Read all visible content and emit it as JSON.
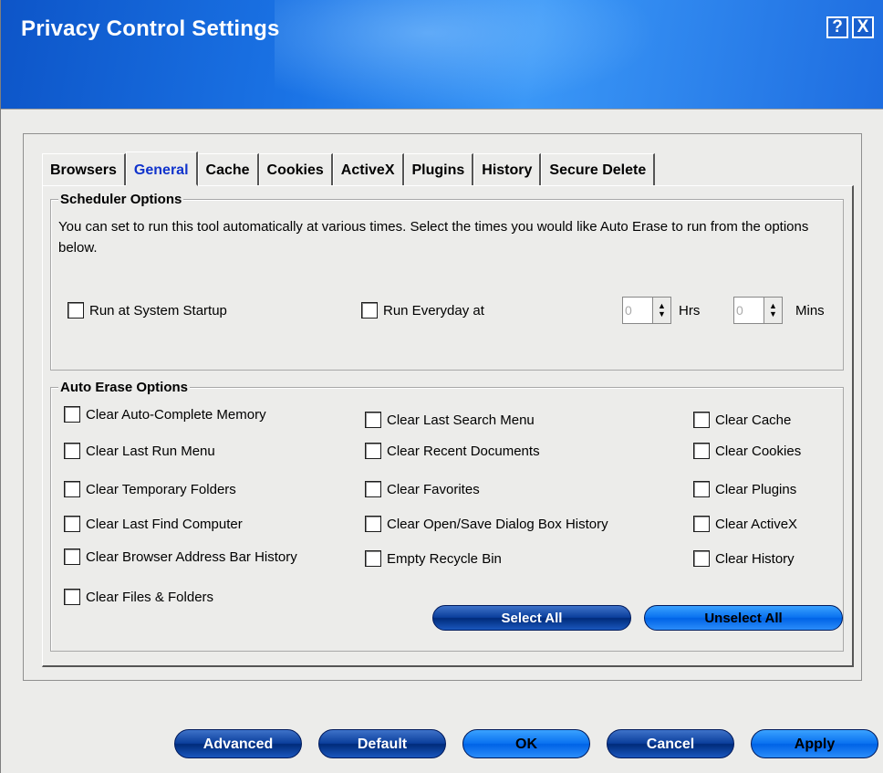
{
  "window": {
    "title": "Privacy Control Settings",
    "help_label": "?",
    "close_label": "X"
  },
  "tabs": [
    "Browsers",
    "General",
    "Cache",
    "Cookies",
    "ActiveX",
    "Plugins",
    "History",
    "Secure Delete"
  ],
  "active_tab": "General",
  "scheduler": {
    "title": "Scheduler Options",
    "description": "You can set to run this tool automatically at various times. Select the times you would like Auto Erase to run from the options below.",
    "run_startup": "Run at System Startup",
    "run_everyday": "Run Everyday at",
    "hours_value": "0",
    "hours_label": "Hrs",
    "mins_value": "0",
    "mins_label": "Mins"
  },
  "auto_erase": {
    "title": "Auto Erase Options",
    "col1": [
      "Clear Auto-Complete Memory",
      "Clear Last Run Menu",
      "Clear Temporary Folders",
      "Clear Last Find Computer",
      "Clear Browser Address Bar History",
      "Clear Files & Folders"
    ],
    "col2": [
      "Clear Last Search Menu",
      "Clear Recent Documents",
      "Clear Favorites",
      "Clear Open/Save Dialog Box History",
      "Empty Recycle Bin"
    ],
    "col3": [
      "Clear Cache",
      "Clear Cookies",
      "Clear Plugins",
      "Clear ActiveX",
      "Clear History"
    ],
    "select_all": "Select All",
    "unselect_all": "Unselect All"
  },
  "footer": {
    "advanced": "Advanced",
    "default": "Default",
    "ok": "OK",
    "cancel": "Cancel",
    "apply": "Apply"
  }
}
